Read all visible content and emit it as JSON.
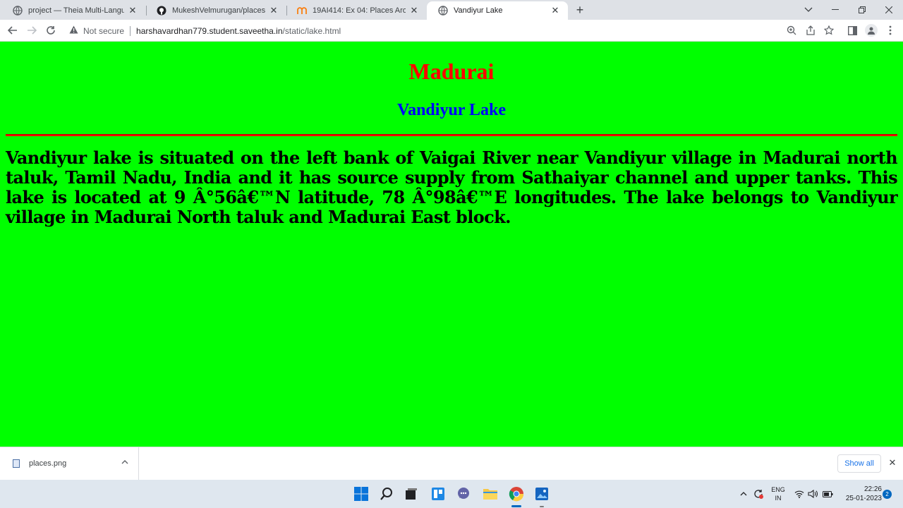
{
  "browser": {
    "tabs": [
      {
        "title": "project — Theia Multi-Language",
        "icon": "globe-icon",
        "active": false
      },
      {
        "title": "MukeshVelmurugan/places-arou",
        "icon": "github-icon",
        "active": false
      },
      {
        "title": "19AI414: Ex 04: Places Around M",
        "icon": "moodle-icon",
        "active": false
      },
      {
        "title": "Vandiyur Lake",
        "icon": "globe-icon",
        "active": true
      }
    ],
    "address": {
      "security_label": "Not secure",
      "host": "harshavardhan779.student.saveetha.in",
      "path": "/static/lake.html"
    }
  },
  "page": {
    "heading": "Madurai",
    "subheading": "Vandiyur Lake",
    "paragraph": "Vandiyur lake is situated on the left bank of Vaigai River near Vandiyur village in Madurai north taluk, Tamil Nadu, India and it has source supply from Sathaiyar channel and upper tanks. This lake is located at 9 Â°56â€™N latitude, 78 Â°98â€™E longitudes. The lake belongs to Vandiyur village in Madurai North taluk and Madurai East block.",
    "background_color": "#00ff00",
    "heading_color": "#ff0000",
    "subheading_color": "#0000ff"
  },
  "downloads": {
    "file_name": "places.png",
    "show_all_label": "Show all"
  },
  "taskbar": {
    "language": "ENG",
    "region": "IN",
    "time": "22:26",
    "date": "25-01-2023",
    "notification_count": "2"
  }
}
